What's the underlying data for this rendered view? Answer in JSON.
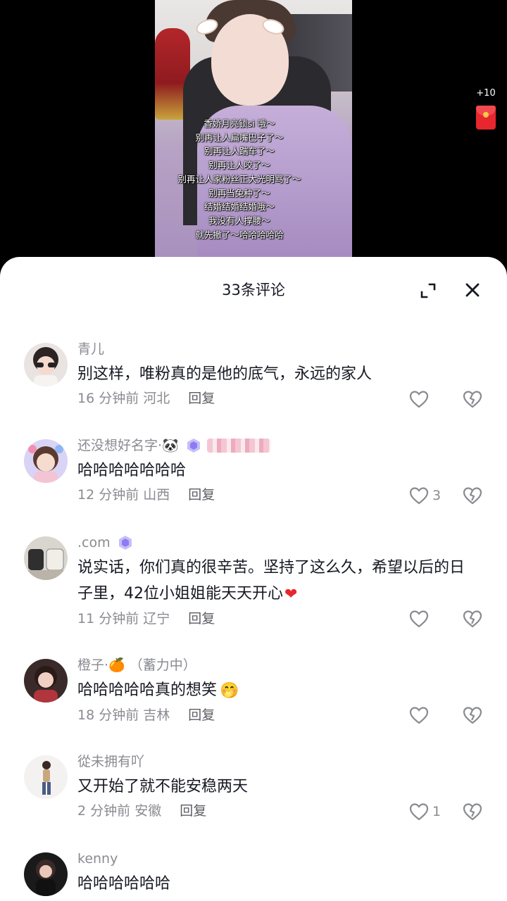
{
  "video": {
    "lyrics": [
      "香娇月亮锁si 哦～",
      "别再让人扁嘴巴子了～",
      "别再让人踹车了～",
      "别再让人咬了～",
      "别再让人家粉丝正大光明骂了～",
      "别再当兔种了～",
      "结婚结婚结婚哦～",
      "我没有人撑腰～",
      "就先撤了～哈哈哈哈哈"
    ],
    "reward_count": "+10"
  },
  "sheet": {
    "title": "33条评论",
    "expand_icon": "expand-icon",
    "close_icon": "close-icon"
  },
  "comments": [
    {
      "name": "青儿",
      "text": "别这样，唯粉真的是他的底气，永远的家人",
      "time": "16 分钟前",
      "location": "河北",
      "reply": "回复",
      "likes": ""
    },
    {
      "name": "还没想好名字·",
      "name_emoji": "🐼",
      "text": "哈哈哈哈哈哈哈",
      "time": "12 分钟前",
      "location": "山西",
      "reply": "回复",
      "likes": "3"
    },
    {
      "name": ".com",
      "text": "说实话，你们真的很辛苦。坚持了这么久，希望以后的日子里，42位小姐姐能天天开心",
      "text_emoji": "❤",
      "time": "11 分钟前",
      "location": "辽宁",
      "reply": "回复",
      "likes": ""
    },
    {
      "name": "橙子·",
      "name_emoji": "🍊",
      "name_suffix": "（蓄力中）",
      "text": "哈哈哈哈哈真的想笑",
      "text_emoji": "🤭",
      "time": "18 分钟前",
      "location": "吉林",
      "reply": "回复",
      "likes": ""
    },
    {
      "name": "從未拥有吖",
      "text": "又开始了就不能安稳两天",
      "time": "2 分钟前",
      "location": "安徽",
      "reply": "回复",
      "likes": "1"
    },
    {
      "name": "kenny",
      "text": "哈哈哈哈哈哈",
      "time": "",
      "location": "",
      "reply": "",
      "likes": ""
    }
  ],
  "colors": {
    "text_primary": "#161823",
    "text_secondary": "#8a8b91",
    "accent_red": "#e8262e",
    "badge_purple": "#8b7cf5"
  }
}
